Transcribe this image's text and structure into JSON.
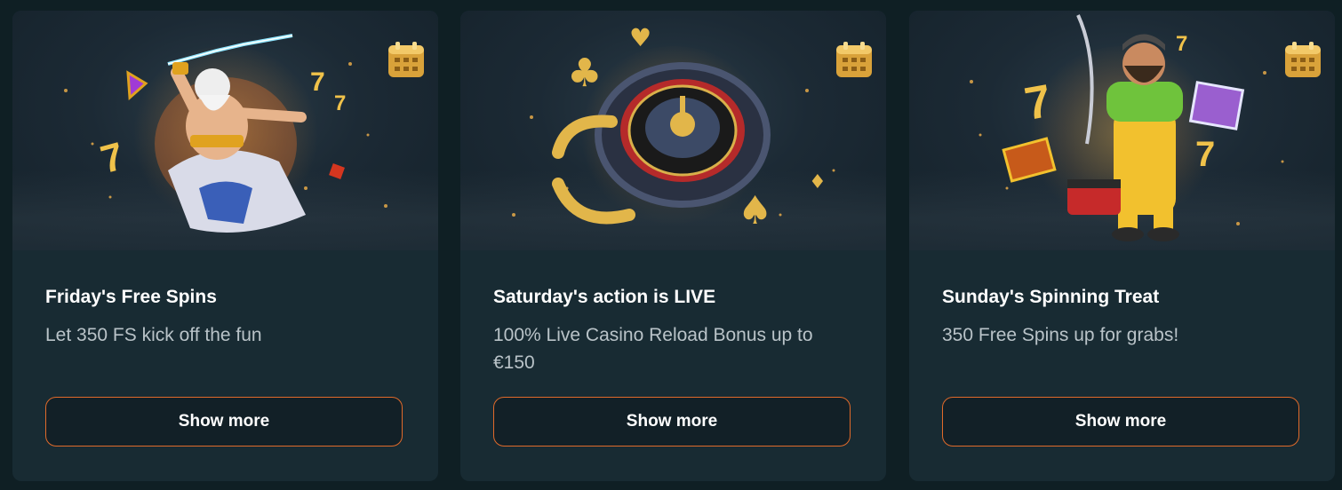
{
  "colors": {
    "page_bg": "#0f1f24",
    "card_bg": "#182b33",
    "button_border": "#e06a2a",
    "title": "#ffffff",
    "description": "#b9c3c8"
  },
  "promotions": [
    {
      "title": "Friday's Free Spins",
      "description": "Let 350 FS kick off the fun",
      "button_label": "Show more",
      "image": "zeus-lightning-slot-art",
      "badge_icon": "calendar-icon"
    },
    {
      "title": "Saturday's action is LIVE",
      "description": "100% Live Casino Reload Bonus up to €150",
      "button_label": "Show more",
      "image": "roulette-wheel-art",
      "badge_icon": "calendar-icon"
    },
    {
      "title": "Sunday's Spinning Treat",
      "description": "350 Free Spins up for grabs!",
      "button_label": "Show more",
      "image": "fisherman-slot-art",
      "badge_icon": "calendar-icon"
    }
  ]
}
